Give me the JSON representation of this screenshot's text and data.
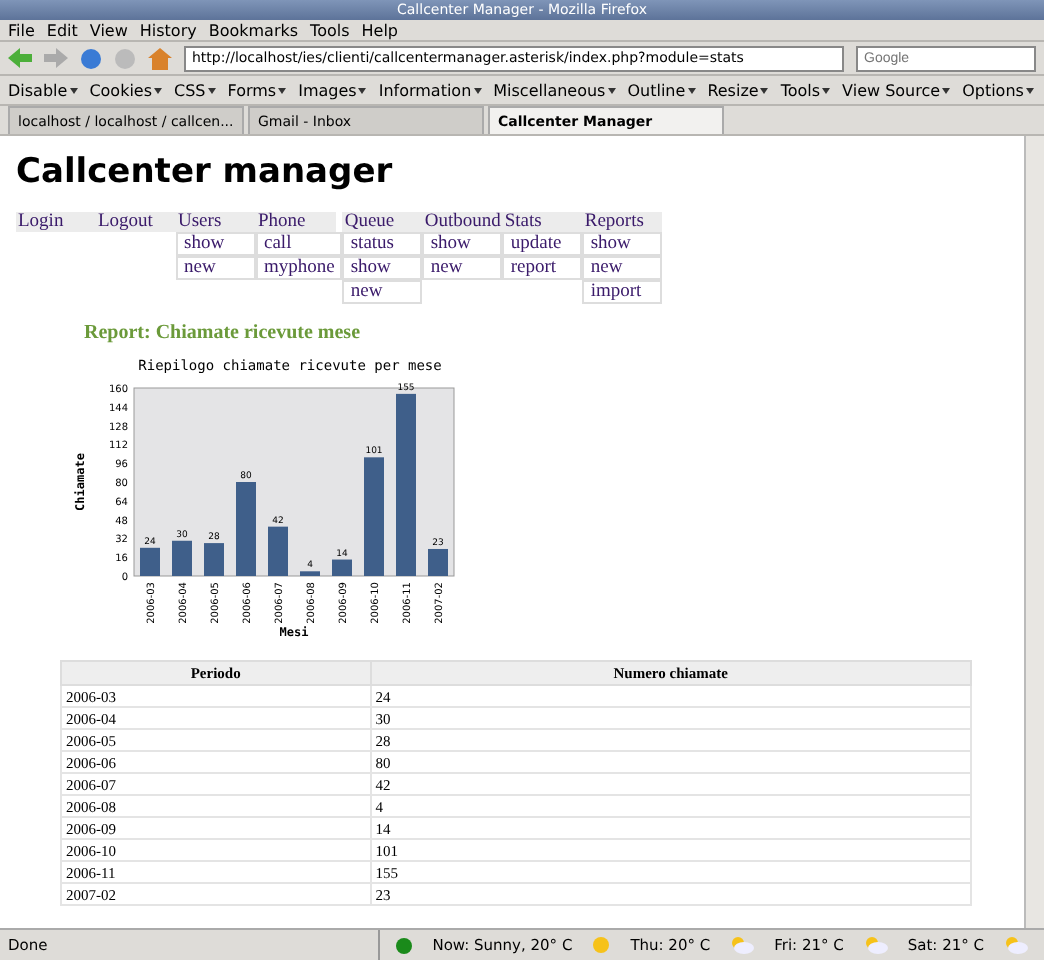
{
  "window": {
    "title": "Callcenter Manager - Mozilla Firefox"
  },
  "menu_bar": [
    "File",
    "Edit",
    "View",
    "History",
    "Bookmarks",
    "Tools",
    "Help"
  ],
  "address_bar": {
    "value": "http://localhost/ies/clienti/callcentermanager.asterisk/index.php?module=stats"
  },
  "search": {
    "placeholder": "Google"
  },
  "dev_toolbar": [
    "Disable",
    "Cookies",
    "CSS",
    "Forms",
    "Images",
    "Information",
    "Miscellaneous",
    "Outline",
    "Resize",
    "Tools",
    "View Source",
    "Options"
  ],
  "tabs": [
    {
      "label": "localhost / localhost / callcen...",
      "selected": false
    },
    {
      "label": "Gmail - Inbox",
      "selected": false
    },
    {
      "label": "Callcenter Manager",
      "selected": true
    }
  ],
  "page": {
    "title": "Callcenter manager",
    "nav": [
      {
        "label": "Login"
      },
      {
        "label": "Logout"
      },
      {
        "label": "Users",
        "items": [
          "show",
          "new"
        ]
      },
      {
        "label": "Phone",
        "items": [
          "call",
          "myphone"
        ]
      },
      {
        "label": "Queue",
        "items": [
          "status",
          "show",
          "new"
        ]
      },
      {
        "label": "Outbound",
        "items": [
          "show",
          "new"
        ]
      },
      {
        "label": "Stats",
        "items": [
          "update",
          "report"
        ]
      },
      {
        "label": "Reports",
        "items": [
          "show",
          "new",
          "import"
        ]
      }
    ],
    "report_title": "Report: Chiamate ricevute mese",
    "chart_data": {
      "type": "bar",
      "title": "Riepilogo chiamate ricevute per mese",
      "xlabel": "Mesi",
      "ylabel": "Chiamate",
      "categories": [
        "2006-03",
        "2006-04",
        "2006-05",
        "2006-06",
        "2006-07",
        "2006-08",
        "2006-09",
        "2006-10",
        "2006-11",
        "2007-02"
      ],
      "series": [
        {
          "color": "#3f5f8a",
          "values": [
            24,
            30,
            28,
            80,
            42,
            4,
            14,
            101,
            155,
            23
          ]
        }
      ],
      "ylim": [
        0,
        160
      ],
      "yticks": [
        0,
        16,
        32,
        48,
        64,
        80,
        96,
        112,
        128,
        144,
        160
      ],
      "data_labels": true
    },
    "table": {
      "columns": [
        "Periodo",
        "Numero chiamate"
      ],
      "rows": [
        [
          "2006-03",
          "24"
        ],
        [
          "2006-04",
          "30"
        ],
        [
          "2006-05",
          "28"
        ],
        [
          "2006-06",
          "80"
        ],
        [
          "2006-07",
          "42"
        ],
        [
          "2006-08",
          "4"
        ],
        [
          "2006-09",
          "14"
        ],
        [
          "2006-10",
          "101"
        ],
        [
          "2006-11",
          "155"
        ],
        [
          "2007-02",
          "23"
        ]
      ]
    }
  },
  "status_bar": {
    "text": "Done",
    "weather": [
      {
        "kind": "sun",
        "text": "Now: Sunny, 20° C"
      },
      {
        "kind": "cloud",
        "text": "Thu: 20° C"
      },
      {
        "kind": "cloud",
        "text": "Fri: 21° C"
      },
      {
        "kind": "cloud",
        "text": "Sat: 21° C"
      }
    ]
  }
}
